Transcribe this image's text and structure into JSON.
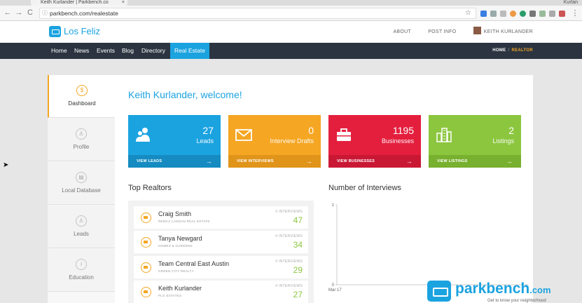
{
  "browser": {
    "tab_title": "Keith Kurlander | Parkbench.co",
    "tab_close": "×",
    "user_name": "Kurlan",
    "url": "parkbench.com/realestate",
    "back_glyph": "←",
    "forward_glyph": "→",
    "reload_glyph": "C",
    "info_glyph": "ⓘ",
    "star_glyph": "☆",
    "menu_glyph": "⋮"
  },
  "header": {
    "site_name": "Los Feliz",
    "links": [
      "ABOUT",
      "POST INFO"
    ],
    "user": "KEITH KURLANDER"
  },
  "nav": {
    "items": [
      "Home",
      "News",
      "Events",
      "Blog",
      "Directory",
      "Real Estate"
    ],
    "active_index": 5,
    "breadcrumb_home": "HOME",
    "breadcrumb_sep": "/",
    "breadcrumb_current": "REALTOR"
  },
  "sidebar": {
    "items": [
      {
        "label": "Dashboard",
        "glyph": "$",
        "icon": "dollar-icon"
      },
      {
        "label": "Profile",
        "glyph": "♙",
        "icon": "person-icon"
      },
      {
        "label": "Local Database",
        "glyph": "▤",
        "icon": "database-icon"
      },
      {
        "label": "Leads",
        "glyph": "♙",
        "icon": "leads-icon"
      },
      {
        "label": "Education",
        "glyph": "i",
        "icon": "info-icon"
      }
    ]
  },
  "welcome": "Keith Kurlander, welcome!",
  "cards": [
    {
      "number": "27",
      "label": "Leads",
      "action": "VIEW LEADS",
      "color": "#1ba3e0",
      "dark": "#158bc1",
      "icon": "people-icon"
    },
    {
      "number": "0",
      "label": "Interview Drafts",
      "action": "VIEW INTERVIEWS",
      "color": "#f5a623",
      "dark": "#e0941a",
      "icon": "envelope-icon"
    },
    {
      "number": "1195",
      "label": "Businesses",
      "action": "VIEW BUSINESSES",
      "color": "#e41f3e",
      "dark": "#c91834",
      "icon": "briefcase-icon"
    },
    {
      "number": "2",
      "label": "Listings",
      "action": "VIEW LISTINGS",
      "color": "#8cc63f",
      "dark": "#78b02f",
      "icon": "building-icon"
    }
  ],
  "card_arrow": "→",
  "top_realtors": {
    "title": "Top Realtors",
    "caption": "# INTERVIEWS",
    "rows": [
      {
        "name": "Craig Smith",
        "org": "REMAX LANDAN REAL ESTATE",
        "count": "47"
      },
      {
        "name": "Tanya Newgard",
        "org": "HOMES & GARDENS",
        "count": "34"
      },
      {
        "name": "Team Central East Austin",
        "org": "GREEN CITY REALTY",
        "count": "29"
      },
      {
        "name": "Keith Kurlander",
        "org": "PLG ESTATES",
        "count": "27"
      }
    ]
  },
  "chart_data": {
    "type": "line",
    "title": "Number of Interviews",
    "categories": [
      "Mar 17"
    ],
    "y_ticks": [
      "0",
      "1"
    ],
    "ylim": [
      0,
      1
    ],
    "series": [],
    "grid": false
  },
  "watermark": {
    "brand": "parkbench",
    "domain": ".com",
    "tagline": "Get to know your neighborhood"
  }
}
